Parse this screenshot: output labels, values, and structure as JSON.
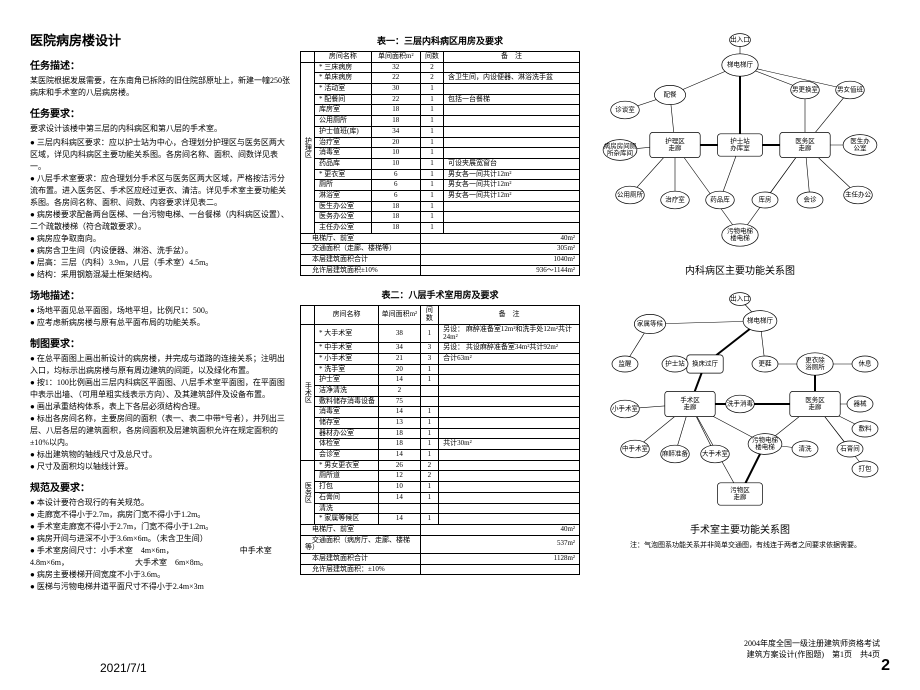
{
  "title": "医院病房楼设计",
  "sections": {
    "task_desc_h": "任务描述：",
    "task_desc_p": "某医院根据发展需要，在东南角已拆除的旧住院部原址上，新建一幢250张病床和手术室的八层病房楼。",
    "task_req_h": "任务要求：",
    "task_req_intro": "要求设计该楼中第三层的内科病区和第八层的手术室。",
    "task_req_items": [
      "三层内科病区要求：应以护士站为中心，合理划分护理区与医务区两大区域，详见内科病区主要功能关系图。各房间名称、面积、间数详见表一。",
      "八层手术室要求：应合理划分手术区与医务区两大区域，严格按洁污分流布置。进入医务区、手术区应经过更衣、清洁。详见手术室主要功能关系图。各房间名称、面积、间数、内容要求详见表二。",
      "病房楼要求配备两台医梯、一台污物电梯、一台餐梯（内科病区设置）、二个疏散楼梯（符合疏散要求）。",
      "病房应争取南向。",
      "病房含卫生间（内设便器、淋浴、洗手盆）。",
      "层高：三层（内科）3.9m，八层（手术室）4.5m。",
      "结构：采用钢筋混凝土框架结构。"
    ],
    "site_desc_h": "场地描述：",
    "site_desc_items": [
      "场地平面见总平面图，场地平坦，比例尺1：500。",
      "应考虑新病房楼与原有总平面布局的功能关系。"
    ],
    "draw_req_h": "制图要求：",
    "draw_req_items": [
      "在总平面图上画出新设计的病房楼，并完成与道路的连接关系；注明出入口，均标示出病房楼与原有周边建筑的间距，以及绿化布置。",
      "按1：100比例画出三层内科病区平面图、八层手术室平面图，在平面图中表示出墙、（可用单粗实线表示方向）、及其建筑部件及设备布置。",
      "画出承重结构体系，表上下各层必须结构合理。",
      "标出各房间名称，主要房间的面积（表一、表二中带*号者），并列出三层、八层各层的建筑面积，各房间面积及层建筑面积允许在规定面积的±10%以内。",
      "标出建筑物的轴线尺寸及总尺寸。",
      "尺寸及面积均以轴线计算。"
    ],
    "spec_req_h": "规范及要求：",
    "spec_req_items": [
      "本设计要符合现行的有关规范。",
      "走廊宽不得小于2.7m，病房门宽不得小于1.2m。",
      "手术室走廊宽不得小于2.7m，门宽不得小于1.2m。",
      "病房开间与进深不小于3.6m×6m。（未含卫生间）",
      "手术室房间尺寸：小手术室　4m×6m，\n　　　　　　　　中手术室　4.8m×6m，\n　　　　　　　　大手术室　6m×8m。",
      "病房主要楼梯开间宽度不小于3.6m。",
      "医梯与污物电梯井道平面尺寸不得小于2.4m×3m"
    ]
  },
  "table1": {
    "title": "表一：三层内科病区用房及要求",
    "headers": [
      "房间名称",
      "单间面积m²",
      "间数",
      "备　注"
    ],
    "groups": [
      {
        "label": "护理区",
        "rows": [
          [
            "* 三床病房",
            "32",
            "2",
            ""
          ],
          [
            "* 单床病房",
            "22",
            "2",
            "含卫生间，内设便器、淋浴洗手盆"
          ],
          [
            "* 活动室",
            "30",
            "1",
            ""
          ],
          [
            "* 配餐间",
            "22",
            "1",
            "包括一台餐梯"
          ],
          [
            "库房室",
            "18",
            "1",
            ""
          ],
          [
            "公用厕所",
            "18",
            "1",
            ""
          ],
          [
            "护士值班(库)",
            "34",
            "1",
            ""
          ],
          [
            "治疗室",
            "20",
            "1",
            ""
          ],
          [
            "消毒室",
            "10",
            "1",
            ""
          ],
          [
            "药品库",
            "10",
            "1",
            "可设夹展宽窗台"
          ],
          [
            "* 更衣室",
            "6",
            "1",
            "男女各一间共计12m²"
          ],
          [
            "厕所",
            "6",
            "1",
            "男女各一间共计12m²"
          ],
          [
            "淋浴室",
            "6",
            "1",
            "男女各一间共计12m²"
          ],
          [
            "医生办公室",
            "18",
            "1",
            ""
          ],
          [
            "医务办公室",
            "18",
            "1",
            ""
          ],
          [
            "主任办公室",
            "18",
            "1",
            ""
          ]
        ]
      }
    ],
    "summary": [
      [
        "电梯厅、前室",
        "40m²"
      ],
      [
        "交通面积（走廊、楼梯等）",
        "305m²"
      ],
      [
        "本层建筑面积合计",
        "1040m²"
      ],
      [
        "允许层建筑面积±10%",
        "936～1144m²"
      ]
    ]
  },
  "table2": {
    "title": "表二：八层手术室用房及要求",
    "headers": [
      "房间名称",
      "单间面积m²",
      "间数",
      "备　注"
    ],
    "groups": [
      {
        "label": "手术区",
        "rows": [
          [
            "* 大手术室",
            "38",
            "1",
            "另设：\n麻醉准备室12m²和洗手处12m²共计24m²"
          ],
          [
            "* 中手术室",
            "34",
            "3",
            "另设：\n共设麻醉准备室34m²共计92m²"
          ],
          [
            "* 小手术室",
            "21",
            "3",
            "合计63m²"
          ],
          [
            "* 洗手室",
            "20",
            "1",
            ""
          ],
          [
            "护士室",
            "14",
            "1",
            ""
          ],
          [
            "洁净清洗",
            "2",
            "",
            ""
          ],
          [
            "敷料储存消毒设备",
            "75",
            "",
            ""
          ],
          [
            "消毒室",
            "14",
            "1",
            ""
          ],
          [
            "储存室",
            "13",
            "1",
            ""
          ],
          [
            "器材办公室",
            "18",
            "1",
            ""
          ],
          [
            "体检室",
            "18",
            "1",
            "共计30m²"
          ],
          [
            "会诊室",
            "14",
            "1",
            ""
          ]
        ]
      },
      {
        "label": "医务区",
        "rows": [
          [
            "* 男女更衣室",
            "26",
            "2",
            ""
          ],
          [
            "厕所道",
            "12",
            "2",
            ""
          ],
          [
            "打包",
            "10",
            "1",
            ""
          ],
          [
            "石膏间",
            "14",
            "1",
            ""
          ],
          [
            "清洗",
            "",
            "",
            ""
          ],
          [
            "* 家属等候区",
            "14",
            "1",
            ""
          ]
        ]
      }
    ],
    "summary": [
      [
        "电梯厅、前室",
        "40m²"
      ],
      [
        "交通面积（病房厅、走廊、楼梯等）",
        "537m²"
      ],
      [
        "本层建筑面积合计",
        "1128m²"
      ],
      [
        "允许层建筑面积：±10%",
        ""
      ]
    ]
  },
  "diagram1": {
    "caption": "内科病区主要功能关系图",
    "nodes": {
      "entry": "出入口",
      "lift": "梯电梯厅",
      "dining": "诊谈室",
      "activity": "配餐",
      "toilet_ward": "病房房间厕所杂库间",
      "ward_corridor": "护理区走廊",
      "nurse": "护士站办库室",
      "service_corridor": "医务区走廊",
      "doctor_office": "医生办公室",
      "male_change": "男更换室",
      "female_change": "男女值班",
      "male_toilet": "公用厕所",
      "treat": "治疗室",
      "pharmacy": "药品库",
      "storage": "库房",
      "meeting": "会诊",
      "director": "主任办公",
      "dirty_lift": "污物电梯楼电梯"
    }
  },
  "diagram2": {
    "caption": "手术室主要功能关系图",
    "note": "注：气泡图系功能关系并非简单交通图，有线连于两者之间要求依据需要。",
    "nodes": {
      "entry": "出入口",
      "family": "家属等候",
      "lift": "梯电梯厅",
      "supervise": "监醒",
      "bed": "换床过厅",
      "nurse": "护士站",
      "change": "更鞋",
      "prep": "更衣除浴厕所",
      "lounge": "休息",
      "surgery_corridor": "手术区走廊",
      "small_op": "小手术室",
      "wash": "洗手消毒",
      "mid_op": "中手术室",
      "anesthesia": "麻醉准备",
      "large_op": "大手术室",
      "service_corridor": "医务区走廊",
      "instrument": "器械",
      "material": "敷料",
      "plaster": "石膏间",
      "package": "打包",
      "dirty_corridor": "污物电梯楼电梯",
      "clean": "清洗",
      "dirty_area": "污物区走廊"
    }
  },
  "footer": {
    "date": "2021/7/1",
    "page": "2",
    "exam_line1": "2004年度全国一级注册建筑师资格考试",
    "exam_line2": "建筑方案设计(作图题)　第1页　共4页"
  }
}
